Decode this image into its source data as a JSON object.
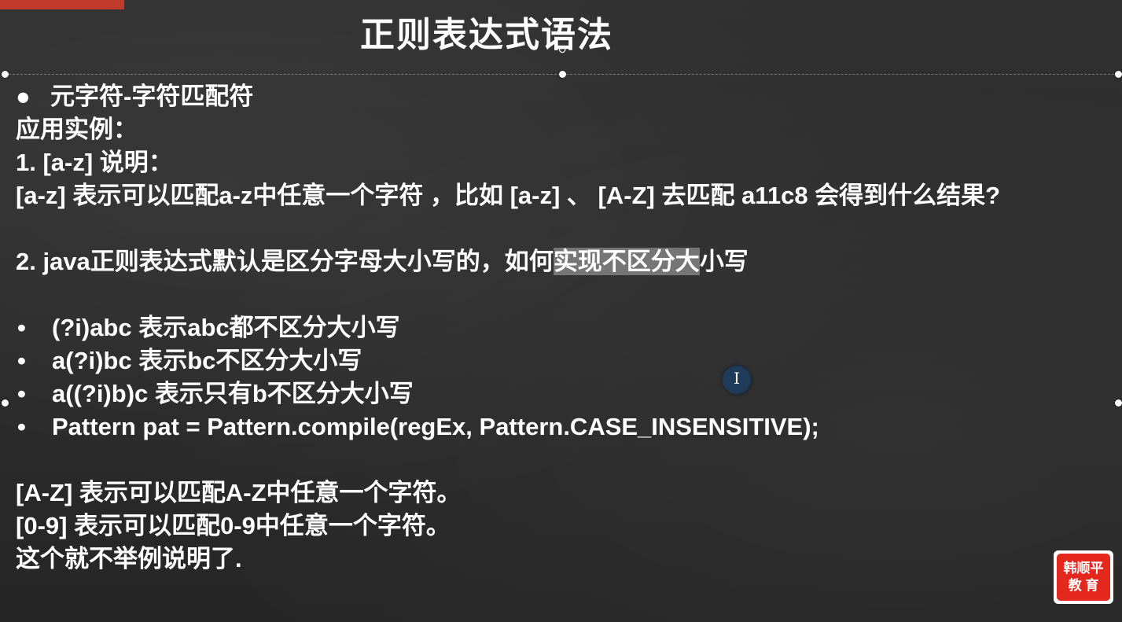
{
  "slide": {
    "title": "正则表达式语法",
    "section": "元字符-字符匹配符",
    "lines": {
      "app_example": "应用实例：",
      "item1": "1.  [a-z] 说明：",
      "item1_desc": "[a-z] 表示可以匹配a-z中任意一个字符 ，比如 [a-z] 、 [A-Z] 去匹配 a11c8  会得到什么结果?",
      "item2_before": "2.  java正则表达式默认是区分字母大小写的，如何",
      "item2_highlight": "实现不区分大",
      "item2_after": "小写",
      "bullets": [
        "(?i)abc 表示abc都不区分大小写",
        "a(?i)bc 表示bc不区分大小写",
        "a((?i)b)c 表示只有b不区分大小写",
        "Pattern pat = Pattern.compile(regEx, Pattern.CASE_INSENSITIVE);"
      ],
      "az_upper": "[A-Z] 表示可以匹配A-Z中任意一个字符。",
      "digits": "[0-9] 表示可以匹配0-9中任意一个字符。",
      "closing": "这个就不举例说明了."
    },
    "bullet_symbol": "●",
    "small_bullet_symbol": "•"
  },
  "logo": {
    "line1": "韩顺平",
    "line2": "教 育"
  },
  "icons": {
    "rotate": "rotate-handle-icon",
    "cursor": "text-cursor-icon"
  },
  "colors": {
    "background": "#2b2b2b",
    "text": "#ffffff",
    "logo_red": "#e5281e",
    "top_bar": "#c0392b"
  }
}
